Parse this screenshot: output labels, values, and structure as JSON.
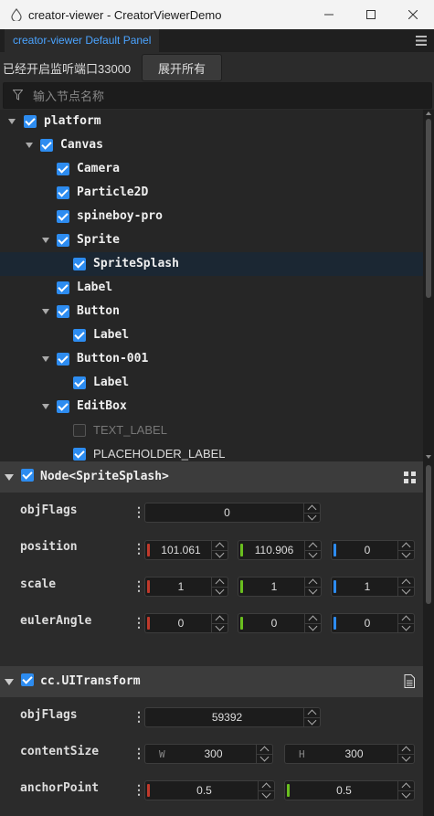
{
  "window": {
    "title": "creator-viewer - CreatorViewerDemo"
  },
  "tab": {
    "label": "creator-viewer Default Panel"
  },
  "toolbar": {
    "port_label": "已经开启监听端口33000",
    "expand_button": "展开所有"
  },
  "search": {
    "placeholder": "输入节点名称",
    "value": ""
  },
  "tree": {
    "nodes": [
      {
        "label": "platform",
        "checked": true,
        "expanded": true
      },
      {
        "label": "Canvas",
        "checked": true,
        "expanded": true
      },
      {
        "label": "Camera",
        "checked": true
      },
      {
        "label": "Particle2D",
        "checked": true
      },
      {
        "label": "spineboy-pro",
        "checked": true
      },
      {
        "label": "Sprite",
        "checked": true,
        "expanded": true
      },
      {
        "label": "SpriteSplash",
        "checked": true,
        "selected": true
      },
      {
        "label": "Label",
        "checked": true
      },
      {
        "label": "Button",
        "checked": true,
        "expanded": true
      },
      {
        "label": "Label",
        "checked": true
      },
      {
        "label": "Button-001",
        "checked": true,
        "expanded": true
      },
      {
        "label": "Label",
        "checked": true
      },
      {
        "label": "EditBox",
        "checked": true,
        "expanded": true
      },
      {
        "label": "TEXT_LABEL",
        "checked": false
      },
      {
        "label": "PLACEHOLDER_LABEL",
        "checked": true
      }
    ]
  },
  "inspector": {
    "node": {
      "title": "Node<SpriteSplash>",
      "enabled": true,
      "props": {
        "objflags": {
          "label": "objFlags",
          "value": "0"
        },
        "position": {
          "label": "position",
          "x": "101.061",
          "y": "110.906",
          "z": "0"
        },
        "scale": {
          "label": "scale",
          "x": "1",
          "y": "1",
          "z": "1"
        },
        "eulerangle": {
          "label": "eulerAngle",
          "x": "0",
          "y": "0",
          "z": "0"
        }
      }
    },
    "uitransform": {
      "title": "cc.UITransform",
      "enabled": true,
      "props": {
        "objflags": {
          "label": "objFlags",
          "value": "59392"
        },
        "contentsize": {
          "label": "contentSize",
          "w_axis": "W",
          "w": "300",
          "h_axis": "H",
          "h": "300"
        },
        "anchorpoint": {
          "label": "anchorPoint",
          "x": "0.5",
          "y": "0.5"
        }
      }
    }
  },
  "colors": {
    "accent": "#2d8cf0",
    "tab_text": "#4aa3ff",
    "x_axis": "#c0392b",
    "y_axis": "#6abf1f",
    "z_axis": "#2d8cf0"
  },
  "icons": {
    "app": "creator-drop-icon",
    "filter": "filter-icon",
    "menu": "hamburger-menu-icon",
    "grid": "grid-icon",
    "doc": "document-icon"
  }
}
